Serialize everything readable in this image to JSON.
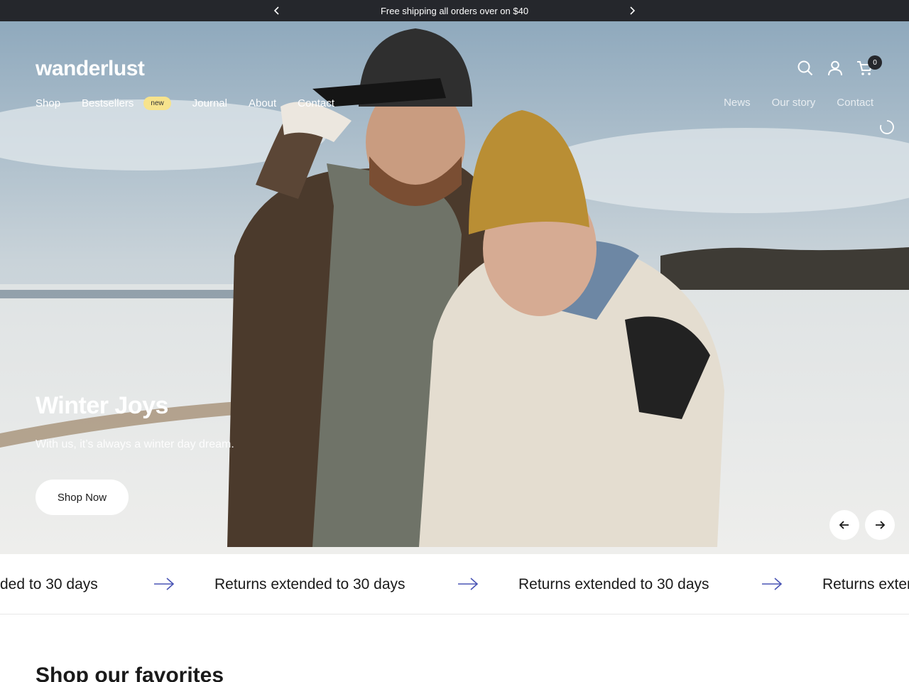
{
  "announcement": {
    "text": "Free shipping all orders over on $40"
  },
  "header": {
    "logo": "wanderlust",
    "nav_left": [
      "Shop",
      "Bestsellers",
      "Journal",
      "About",
      "Contact"
    ],
    "badge": "new",
    "nav_right": [
      "News",
      "Our story",
      "Contact"
    ],
    "cart_count": "0"
  },
  "hero": {
    "title": "Winter Joys",
    "subtitle": "With us, it’s always a winter day dream.",
    "cta": "Shop Now"
  },
  "marquee": {
    "items": [
      "ded to 30 days",
      "Returns extended to 30 days",
      "Returns extended to 30 days",
      "Returns exter"
    ],
    "arrow_color": "#4a55b5"
  },
  "section": {
    "title": "Shop our favorites"
  },
  "icons": [
    "chevron-left-icon",
    "chevron-right-icon",
    "search-icon",
    "user-icon",
    "cart-icon",
    "spinner-icon",
    "arrow-left-icon",
    "arrow-right-icon"
  ]
}
